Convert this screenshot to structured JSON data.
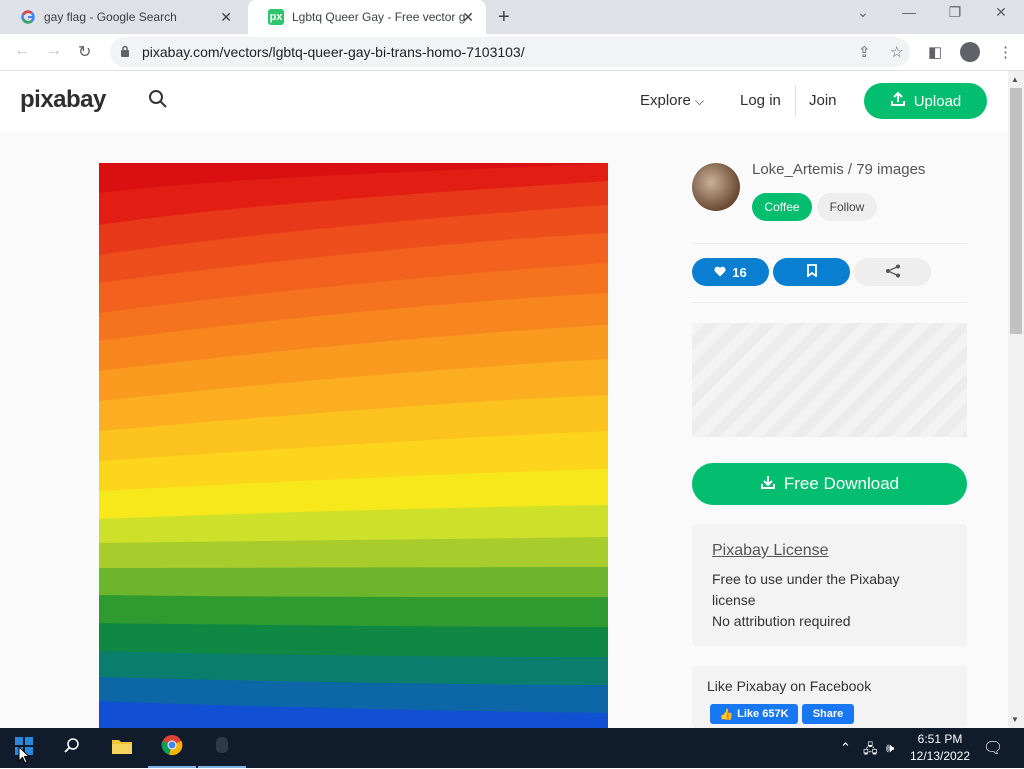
{
  "browser": {
    "tabs": [
      {
        "title": "gay flag - Google Search",
        "favicon": "google-icon"
      },
      {
        "title": "Lgbtq Queer Gay - Free vector g",
        "favicon": "pixabay-px-icon",
        "favicon_text": "px"
      }
    ],
    "url": "pixabay.com/vectors/lgbtq-queer-gay-bi-trans-homo-7103103/"
  },
  "site": {
    "logo": "pixabay",
    "nav": {
      "explore": "Explore",
      "login": "Log in",
      "join": "Join",
      "upload": "Upload"
    }
  },
  "author": {
    "name_line": "Loke_Artemis / 79 images",
    "coffee": "Coffee",
    "follow": "Follow"
  },
  "actions": {
    "likes": "16"
  },
  "download": {
    "label": "Free Download"
  },
  "license": {
    "title": "Pixabay License",
    "line1": "Free to use under the Pixabay",
    "line2": "license",
    "line3": "No attribution required"
  },
  "facebook": {
    "title": "Like Pixabay on Facebook",
    "like": "Like 657K",
    "share": "Share"
  },
  "taskbar": {
    "time": "6:51 PM",
    "date": "12/13/2022"
  },
  "colors": {
    "accent": "#02be6e",
    "action_blue": "#0a7fd1",
    "facebook": "#1877f2"
  }
}
